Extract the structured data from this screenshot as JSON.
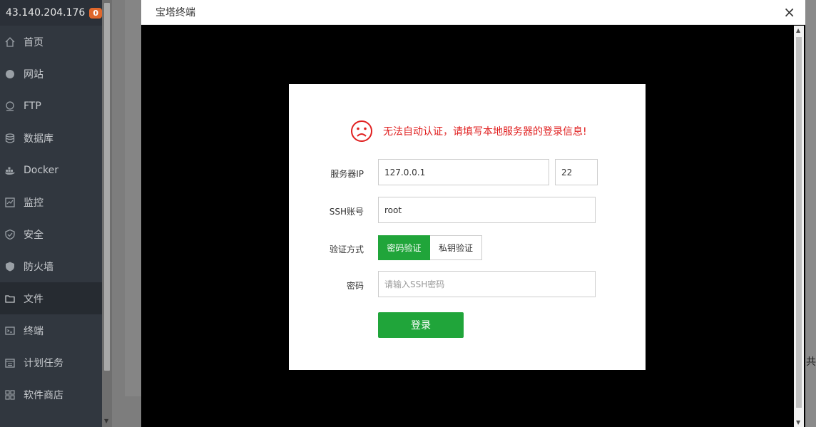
{
  "sidebar": {
    "server_ip": "43.140.204.176",
    "badge_count": "0",
    "items": [
      {
        "label": "首页",
        "icon": "home-icon"
      },
      {
        "label": "网站",
        "icon": "globe-icon"
      },
      {
        "label": "FTP",
        "icon": "ftp-icon"
      },
      {
        "label": "数据库",
        "icon": "database-icon"
      },
      {
        "label": "Docker",
        "icon": "docker-icon"
      },
      {
        "label": "监控",
        "icon": "monitor-icon"
      },
      {
        "label": "安全",
        "icon": "shield-check-icon"
      },
      {
        "label": "防火墙",
        "icon": "firewall-icon"
      },
      {
        "label": "文件",
        "icon": "folder-icon",
        "active": true
      },
      {
        "label": "终端",
        "icon": "terminal-icon"
      },
      {
        "label": "计划任务",
        "icon": "calendar-icon"
      },
      {
        "label": "软件商店",
        "icon": "apps-icon"
      }
    ]
  },
  "background": {
    "right_edge_char": "共"
  },
  "dialog": {
    "title": "宝塔终端",
    "close_glyph": "×"
  },
  "login": {
    "warning": "无法自动认证，请填写本地服务器的登录信息!",
    "ip_label": "服务器IP",
    "ip_value": "127.0.0.1",
    "port_value": "22",
    "account_label": "SSH账号",
    "account_value": "root",
    "auth_label": "验证方式",
    "auth_options": [
      "密码验证",
      "私钥验证"
    ],
    "password_label": "密码",
    "password_placeholder": "请输入SSH密码",
    "submit_label": "登录"
  },
  "colors": {
    "accent_green": "#20a53a",
    "warning_red": "#e02020",
    "badge_orange": "#e0672c",
    "sidebar_bg": "#31373f"
  }
}
